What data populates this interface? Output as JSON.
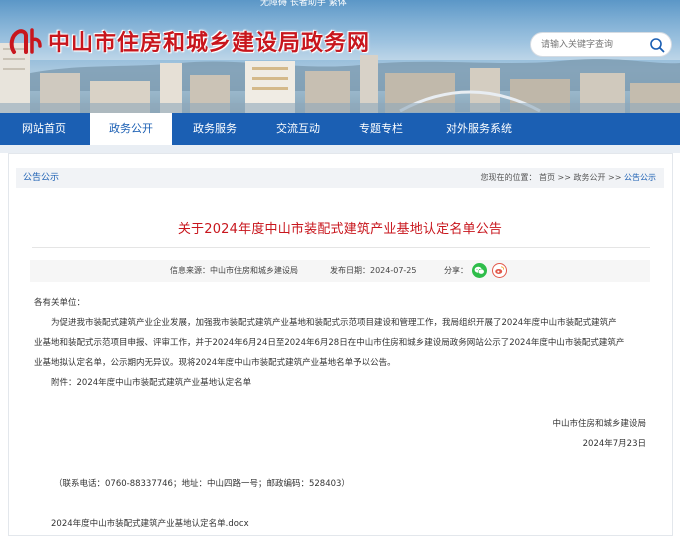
{
  "header": {
    "top_strip": "无障碍  长者助手  繁体",
    "site_title": "中山市住房和城乡建设局政务网",
    "search": {
      "placeholder": "请输入关键字查询"
    }
  },
  "nav": {
    "items": [
      {
        "label": "网站首页"
      },
      {
        "label": "政务公开",
        "active": true
      },
      {
        "label": "政务服务"
      },
      {
        "label": "交流互动"
      },
      {
        "label": "专题专栏"
      },
      {
        "label": "对外服务系统"
      }
    ]
  },
  "breadcrumb": {
    "section": "公告公示",
    "location_label": "您现在的位置：",
    "path": [
      "首页",
      "政务公开",
      "公告公示"
    ],
    "separator": ">>"
  },
  "article": {
    "title": "关于2024年度中山市装配式建筑产业基地认定名单公告",
    "meta": {
      "source": "信息来源：中山市住房和城乡建设局",
      "date": "发布日期：2024-07-25",
      "share_label": "分享："
    },
    "greeting": "各有关单位：",
    "paragraph_lines": [
      "为促进我市装配式建筑产业企业发展，加强我市装配式建筑产业基地和装配式示范项目建设和管理工作，我局组织开展了2024年度中山市装配式建筑产",
      "业基地和装配式示范项目申报、评审工作，并于2024年6月24日至2024年6月28日在中山市住房和城乡建设局政务网站公示了2024年度中山市装配式建筑产",
      "业基地拟认定名单，公示期内无异议。现将2024年度中山市装配式建筑产业基地名单予以公告。"
    ],
    "attachment_note": "附件：2024年度中山市装配式建筑产业基地认定名单",
    "signature_org": "中山市住房和城乡建设局",
    "signature_date": "2024年7月23日",
    "contact": "（联系电话：0760-88337746；地址：中山四路一号；邮政编码：528403）",
    "attachment_file": "2024年度中山市装配式建筑产业基地认定名单.docx"
  },
  "colors": {
    "brand_red": "#c8161d",
    "nav_blue": "#1b5fb3",
    "wechat_green": "#2ebd4a",
    "weibo_red": "#e2584a"
  },
  "icons": {
    "logo": "building-logo-icon",
    "search": "search-icon",
    "wechat": "wechat-icon",
    "weibo": "weibo-icon"
  }
}
